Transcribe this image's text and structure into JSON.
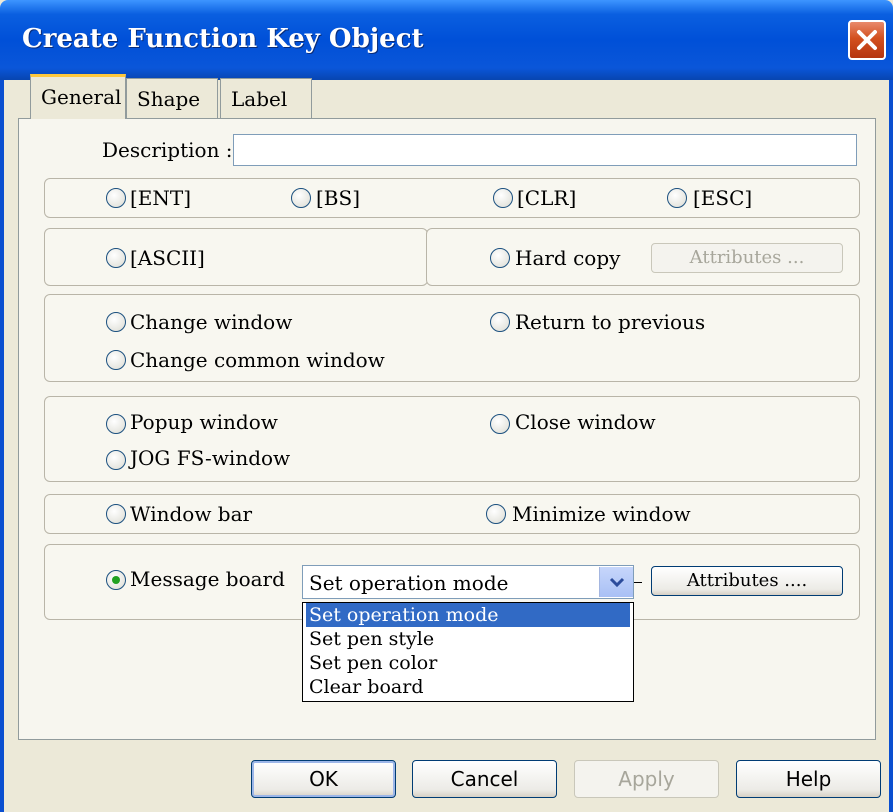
{
  "window": {
    "title": "Create Function Key Object",
    "close_icon": "close-icon"
  },
  "tabs": [
    {
      "label": "General",
      "active": true
    },
    {
      "label": "Shape",
      "active": false
    },
    {
      "label": "Label",
      "active": false
    }
  ],
  "description": {
    "label": "Description :",
    "value": ""
  },
  "keys_row": [
    "[ENT]",
    "[BS]",
    "[CLR]",
    "[ESC]"
  ],
  "ascii_group": {
    "ascii": "[ASCII]",
    "hard_copy": "Hard copy",
    "attributes_button": "Attributes ..."
  },
  "window_group": {
    "change_window": "Change window",
    "return_to_previous": "Return to previous",
    "change_common_window": "Change common window"
  },
  "popup_group": {
    "popup_window": "Popup window",
    "close_window": "Close window",
    "jog_fs_window": "JOG FS-window"
  },
  "bar_group": {
    "window_bar": "Window bar",
    "minimize_window": "Minimize window"
  },
  "message_group": {
    "message_board": "Message board",
    "selected_option": "Set operation mode",
    "options": [
      "Set operation mode",
      "Set pen style",
      "Set pen color",
      "Clear board"
    ],
    "attributes_button": "Attributes ...."
  },
  "footer": {
    "ok": "OK",
    "cancel": "Cancel",
    "apply": "Apply",
    "help": "Help"
  },
  "colors": {
    "titlebar": "#0a56d9",
    "selection": "#316ac5",
    "radio_dot": "#21a121",
    "active_tab_highlight": "#ffc83c"
  }
}
